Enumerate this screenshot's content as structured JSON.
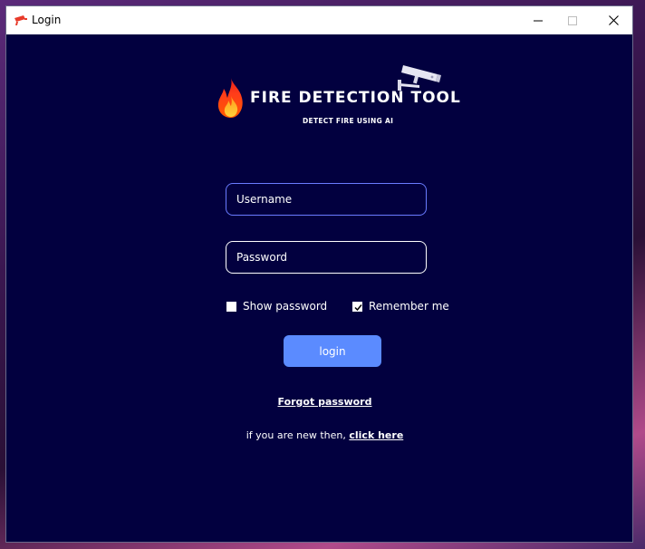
{
  "window": {
    "title": "Login",
    "icon": "camera-app-icon",
    "controls": [
      "minimize-icon",
      "maximize-icon",
      "close-icon"
    ]
  },
  "header": {
    "title": "FIRE DETECTION TOOL",
    "subtitle": "DETECT FIRE USING AI",
    "logo_icons": [
      "flame-icon",
      "security-camera-icon"
    ]
  },
  "form": {
    "username_placeholder": "Username",
    "username_value": "",
    "password_placeholder": "Password",
    "password_value": "",
    "show_password_label": "Show password",
    "show_password_checked": false,
    "remember_me_label": "Remember me",
    "remember_me_checked": true,
    "login_label": "login",
    "forgot_password": "Forgot password",
    "signup_prefix": "if you are new then, ",
    "signup_link": "click here"
  },
  "colors": {
    "background": "#02003f",
    "accent": "#5b8bff",
    "username_border": "#6a7bff"
  }
}
